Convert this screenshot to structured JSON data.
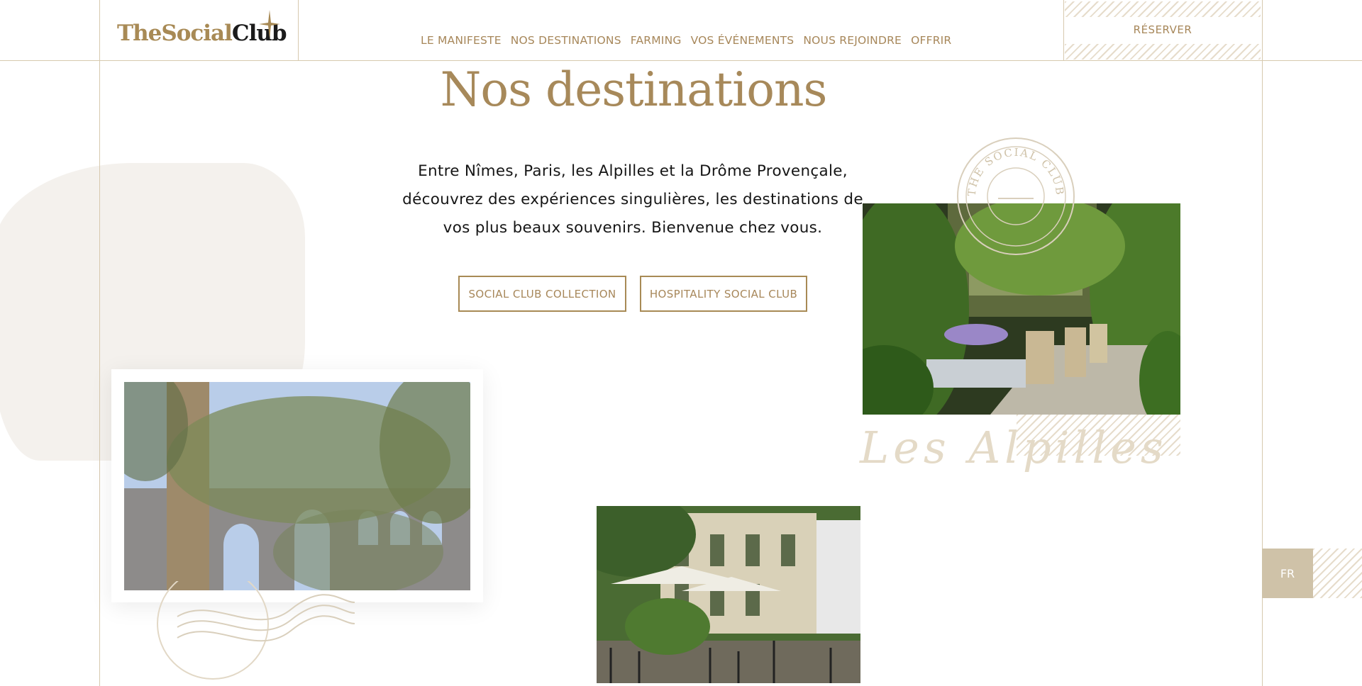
{
  "brand": {
    "logo_part1": "TheSocial",
    "logo_part2": "Club"
  },
  "nav": [
    {
      "label": "LE MANIFESTE"
    },
    {
      "label": "NOS DESTINATIONS"
    },
    {
      "label": "FARMING"
    },
    {
      "label": "VOS ÉVÉNEMENTS"
    },
    {
      "label": "NOUS REJOINDRE"
    },
    {
      "label": "OFFRIR"
    }
  ],
  "header": {
    "reserve_label": "RÉSERVER"
  },
  "main": {
    "title": "Nos destinations",
    "intro": "Entre Nîmes, Paris, les Alpilles et la Drôme Provençale, découvrez des expériences singulières, les destinations de vos plus beaux souvenirs. Bienvenue chez vous.",
    "buttons": [
      "SOCIAL CLUB COLLECTION",
      "HOSPITALITY SOCIAL CLUB"
    ],
    "stamp_text": "THE SOCIAL CLUB",
    "destinations": [
      {
        "script_label": "Les Alpilles"
      }
    ]
  },
  "language": {
    "current": "FR"
  },
  "colors": {
    "accent": "#a7875a",
    "line": "#d7c9ae",
    "lang_bg": "#cfc2a8"
  }
}
